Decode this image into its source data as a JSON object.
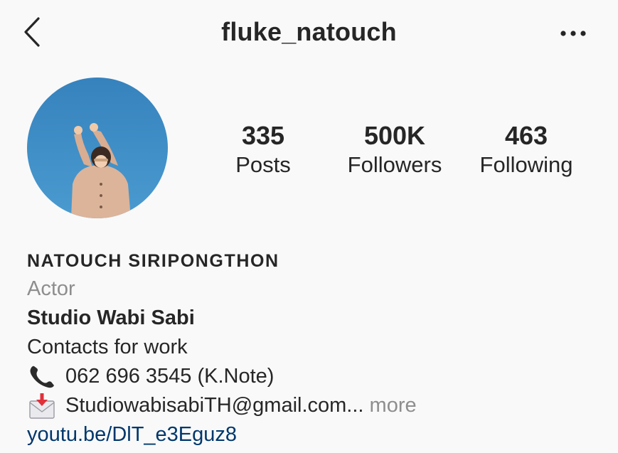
{
  "header": {
    "title": "fluke_natouch",
    "back_icon": "chevron-left-icon",
    "more_icon": "more-horizontal-icon"
  },
  "profile": {
    "avatar_icon": "profile-photo",
    "stats": [
      {
        "value": "335",
        "label": "Posts"
      },
      {
        "value": "500K",
        "label": "Followers"
      },
      {
        "value": "463",
        "label": "Following"
      }
    ]
  },
  "bio": {
    "full_name": "NATOUCH SIRIPONGTHON",
    "category": "Actor",
    "studio": "Studio Wabi Sabi",
    "contacts": "Contacts for work",
    "phone": "062 696 3545 (K.Note)",
    "email": "StudiowabisabiTH@gmail.com...",
    "more": "more",
    "link": "youtu.be/DlT_e3Eguz8"
  },
  "colors": {
    "background": "#f9f9fa",
    "text": "#262626",
    "secondary": "#8e8e8e",
    "link": "#00376b",
    "avatar_sky": "#3c8fc4"
  }
}
